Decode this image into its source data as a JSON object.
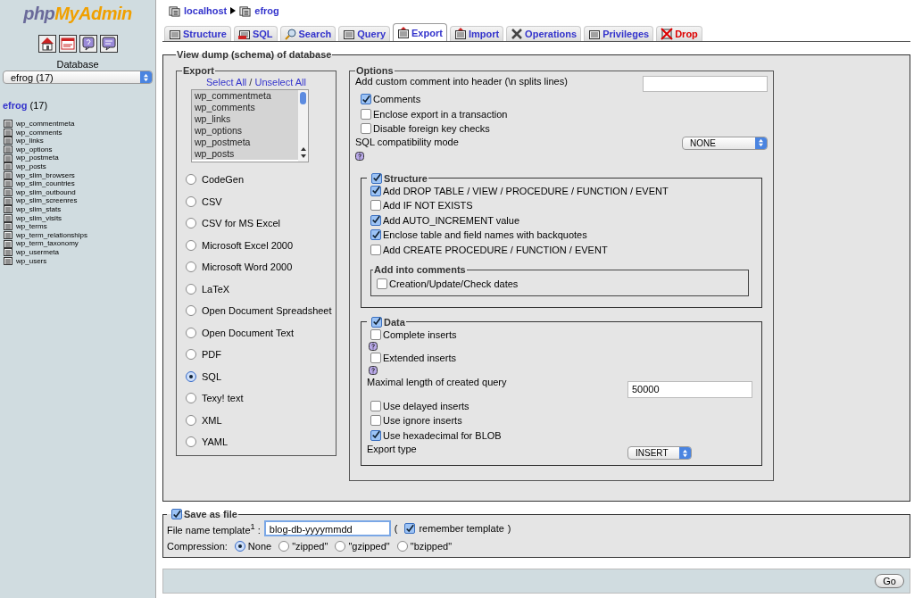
{
  "sidebar": {
    "logo": {
      "part_1": "php",
      "part_2": "MyAdmin"
    },
    "database_label": "Database",
    "database_select": "efrog (17)",
    "db_link": "efrog",
    "db_count": "(17)",
    "tables": [
      "wp_commentmeta",
      "wp_comments",
      "wp_links",
      "wp_options",
      "wp_postmeta",
      "wp_posts",
      "wp_slim_browsers",
      "wp_slim_countries",
      "wp_slim_outbound",
      "wp_slim_screenres",
      "wp_slim_stats",
      "wp_slim_visits",
      "wp_terms",
      "wp_term_relationships",
      "wp_term_taxonomy",
      "wp_usermeta",
      "wp_users"
    ]
  },
  "breadcrumb": [
    "localhost",
    "efrog"
  ],
  "tabs": [
    {
      "label": "Structure",
      "selected": false,
      "kind": "normal"
    },
    {
      "label": "SQL",
      "selected": false,
      "kind": "normal"
    },
    {
      "label": "Search",
      "selected": false,
      "kind": "normal"
    },
    {
      "label": "Query",
      "selected": false,
      "kind": "normal"
    },
    {
      "label": "Export",
      "selected": true,
      "kind": "normal"
    },
    {
      "label": "Import",
      "selected": false,
      "kind": "normal"
    },
    {
      "label": "Operations",
      "selected": false,
      "kind": "normal"
    },
    {
      "label": "Privileges",
      "selected": false,
      "kind": "normal"
    },
    {
      "label": "Drop",
      "selected": false,
      "kind": "danger"
    }
  ],
  "dump": {
    "legend": "View dump (schema) of database",
    "export": {
      "legend": "Export",
      "select_all": "Select All",
      "separator": "/",
      "unselect_all": "Unselect All",
      "tables": [
        {
          "name": "wp_commentmeta",
          "selected": true
        },
        {
          "name": "wp_comments",
          "selected": true
        },
        {
          "name": "wp_links",
          "selected": true
        },
        {
          "name": "wp_options",
          "selected": true
        },
        {
          "name": "wp_postmeta",
          "selected": true
        },
        {
          "name": "wp_posts",
          "selected": true
        }
      ],
      "formats": [
        {
          "label": "CodeGen",
          "selected": false
        },
        {
          "label": "CSV",
          "selected": false
        },
        {
          "label": "CSV for MS Excel",
          "selected": false
        },
        {
          "label": "Microsoft Excel 2000",
          "selected": false
        },
        {
          "label": "Microsoft Word 2000",
          "selected": false
        },
        {
          "label": "LaTeX",
          "selected": false
        },
        {
          "label": "Open Document Spreadsheet",
          "selected": false
        },
        {
          "label": "Open Document Text",
          "selected": false
        },
        {
          "label": "PDF",
          "selected": false
        },
        {
          "label": "SQL",
          "selected": true
        },
        {
          "label": "Texy! text",
          "selected": false
        },
        {
          "label": "XML",
          "selected": false
        },
        {
          "label": "YAML",
          "selected": false
        }
      ]
    },
    "options": {
      "legend": "Options",
      "comment_label": "Add custom comment into header (\\n splits lines)",
      "checks": [
        {
          "label": "Comments",
          "checked": true
        },
        {
          "label": "Enclose export in a transaction",
          "checked": false
        },
        {
          "label": "Disable foreign key checks",
          "checked": false
        }
      ],
      "compat_label": "SQL compatibility mode",
      "compat_value": "NONE",
      "structure": {
        "legend": "Structure",
        "checked": true,
        "checks": [
          {
            "label": "Add DROP TABLE / VIEW / PROCEDURE / FUNCTION / EVENT",
            "checked": true
          },
          {
            "label": "Add IF NOT EXISTS",
            "checked": false
          },
          {
            "label": "Add AUTO_INCREMENT value",
            "checked": true
          },
          {
            "label": "Enclose table and field names with backquotes",
            "checked": true
          },
          {
            "label": "Add CREATE PROCEDURE / FUNCTION / EVENT",
            "checked": false
          }
        ],
        "comments": {
          "legend": "Add into comments",
          "checks": [
            {
              "label": "Creation/Update/Check dates",
              "checked": false
            }
          ]
        }
      },
      "data": {
        "legend": "Data",
        "checked": true,
        "rows": [
          {
            "kind": "checkbox",
            "label": "Complete inserts",
            "checked": false
          },
          {
            "kind": "help"
          },
          {
            "kind": "checkbox",
            "label": "Extended inserts",
            "checked": false
          },
          {
            "kind": "help"
          },
          {
            "kind": "field",
            "label": "Maximal length of created query",
            "value": "50000"
          },
          {
            "kind": "checkbox",
            "label": "Use delayed inserts",
            "checked": false
          },
          {
            "kind": "checkbox",
            "label": "Use ignore inserts",
            "checked": false
          },
          {
            "kind": "checkbox",
            "label": "Use hexadecimal for BLOB",
            "checked": true
          },
          {
            "kind": "select",
            "label": "Export type",
            "value": "INSERT"
          }
        ]
      }
    }
  },
  "save": {
    "legend": "Save as file",
    "checked": true,
    "file_label": "File name template$^{1}$ :",
    "file_value": "blog-db-yyyymmdd",
    "open_paren": "(",
    "remember_checked": true,
    "remember_label": "remember template",
    "close_paren": ")",
    "compression_label": "Compression:",
    "compression": [
      {
        "label": "None",
        "selected": true
      },
      {
        "label": "\"zipped\"",
        "selected": false
      },
      {
        "label": "\"gzipped\"",
        "selected": false
      },
      {
        "label": "\"bzipped\"",
        "selected": false
      }
    ]
  },
  "go": "Go"
}
